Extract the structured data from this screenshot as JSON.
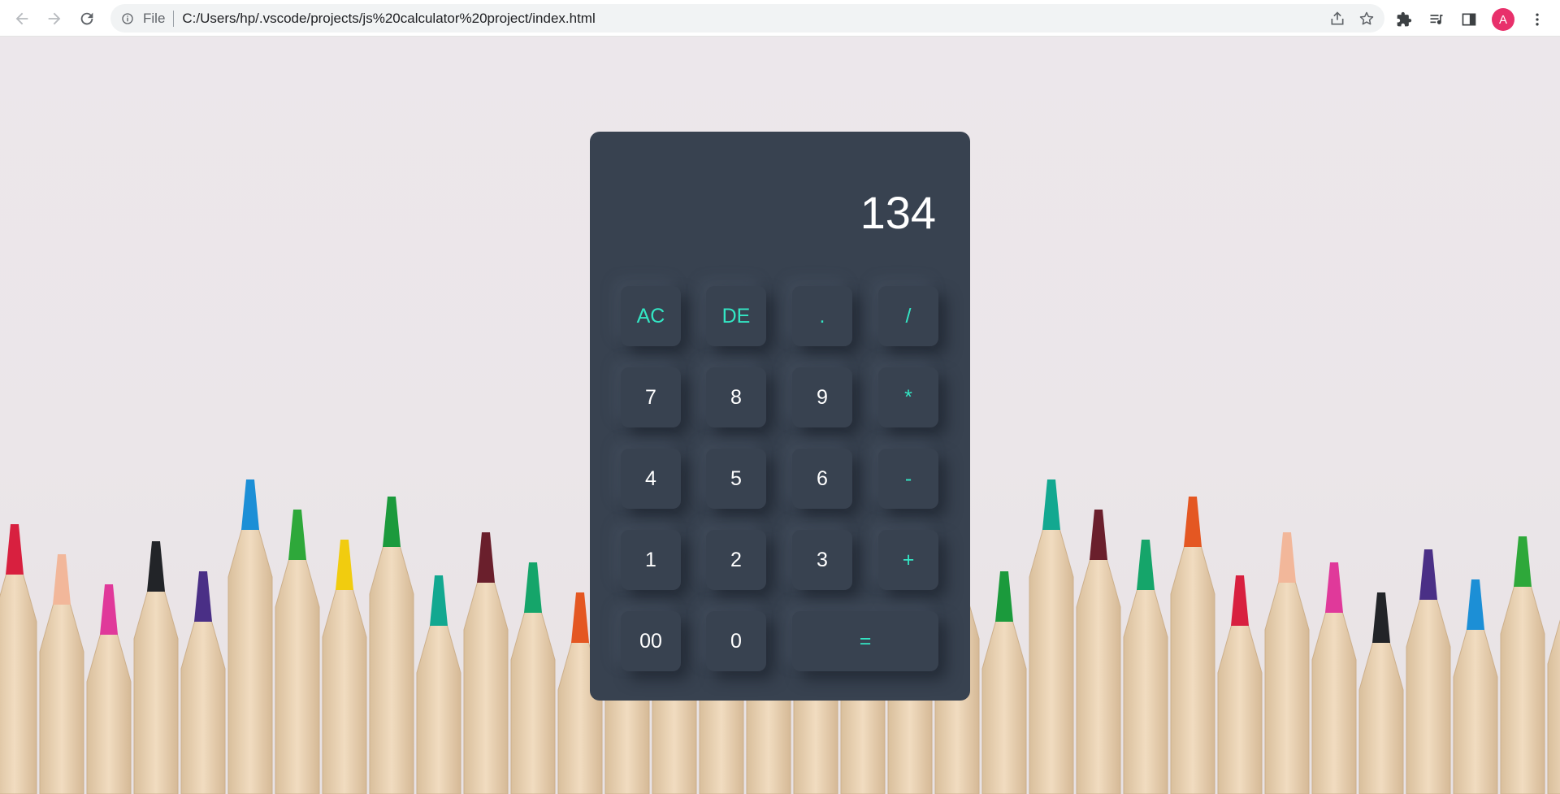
{
  "browser": {
    "scheme_label": "File",
    "url": "C:/Users/hp/.vscode/projects/js%20calculator%20project/index.html",
    "profile_initial": "A",
    "profile_color": "#e8306b",
    "icons": [
      "back-icon",
      "forward-icon",
      "reload-icon",
      "info-icon",
      "share-icon",
      "star-icon",
      "extensions-icon",
      "media-queue-icon",
      "side-panel-icon",
      "menu-icon"
    ]
  },
  "calculator": {
    "display_value": "134",
    "accent_color": "#33e6c4",
    "body_color": "#384250",
    "keys": {
      "ac": "AC",
      "de": "DE",
      "dot": ".",
      "divide": "/",
      "seven": "7",
      "eight": "8",
      "nine": "9",
      "multiply": "*",
      "four": "4",
      "five": "5",
      "six": "6",
      "minus": "-",
      "one": "1",
      "two": "2",
      "three": "3",
      "plus": "+",
      "double_zero": "00",
      "zero": "0",
      "equals": "="
    }
  },
  "background": {
    "description_icon": "colored-pencils-background"
  }
}
